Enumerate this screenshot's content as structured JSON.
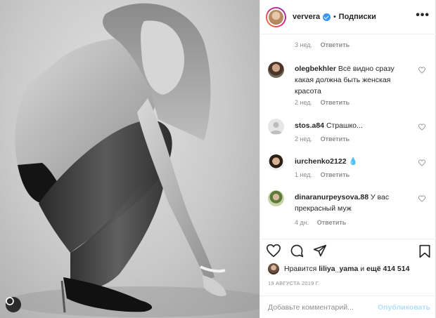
{
  "post": {
    "icons": {
      "photo_badge": "circle-icon"
    }
  },
  "header": {
    "username": "ververa",
    "separator": "•",
    "follow_label": "Подписки",
    "more_label": "•••"
  },
  "top_comment_meta": {
    "time": "3 нед.",
    "reply": "Ответить"
  },
  "comments": [
    {
      "username": "olegbekhler",
      "text": "Всё видно сразу какая должна быть женская красота",
      "time": "2 нед.",
      "reply": "Ответить"
    },
    {
      "username": "stos.a84",
      "text": "Страшко...",
      "time": "2 нед.",
      "reply": "Ответить"
    },
    {
      "username": "iurchenko2122",
      "text": "💧",
      "time": "1 нед.",
      "reply": "Ответить"
    },
    {
      "username": "dinaranurpeysova.88",
      "text": "У вас прекрасный муж",
      "time": "4 дн.",
      "reply": "Ответить"
    }
  ],
  "actions": {
    "icons": [
      "heart-icon",
      "comment-icon",
      "share-icon",
      "bookmark-icon"
    ],
    "likes_prefix": "Нравится",
    "likes_user": "liliya_yama",
    "likes_middle": "и",
    "likes_count": "ещё 414 514",
    "date": "19 АВГУСТА 2019 Г.",
    "comment_placeholder": "Добавьте комментарий...",
    "publish_label": "Опубликовать"
  },
  "colors": {
    "accent_blue": "#3897f0",
    "publish_disabled": "#b2dffc",
    "muted_text": "#8e8e8e",
    "border": "#efefef"
  }
}
